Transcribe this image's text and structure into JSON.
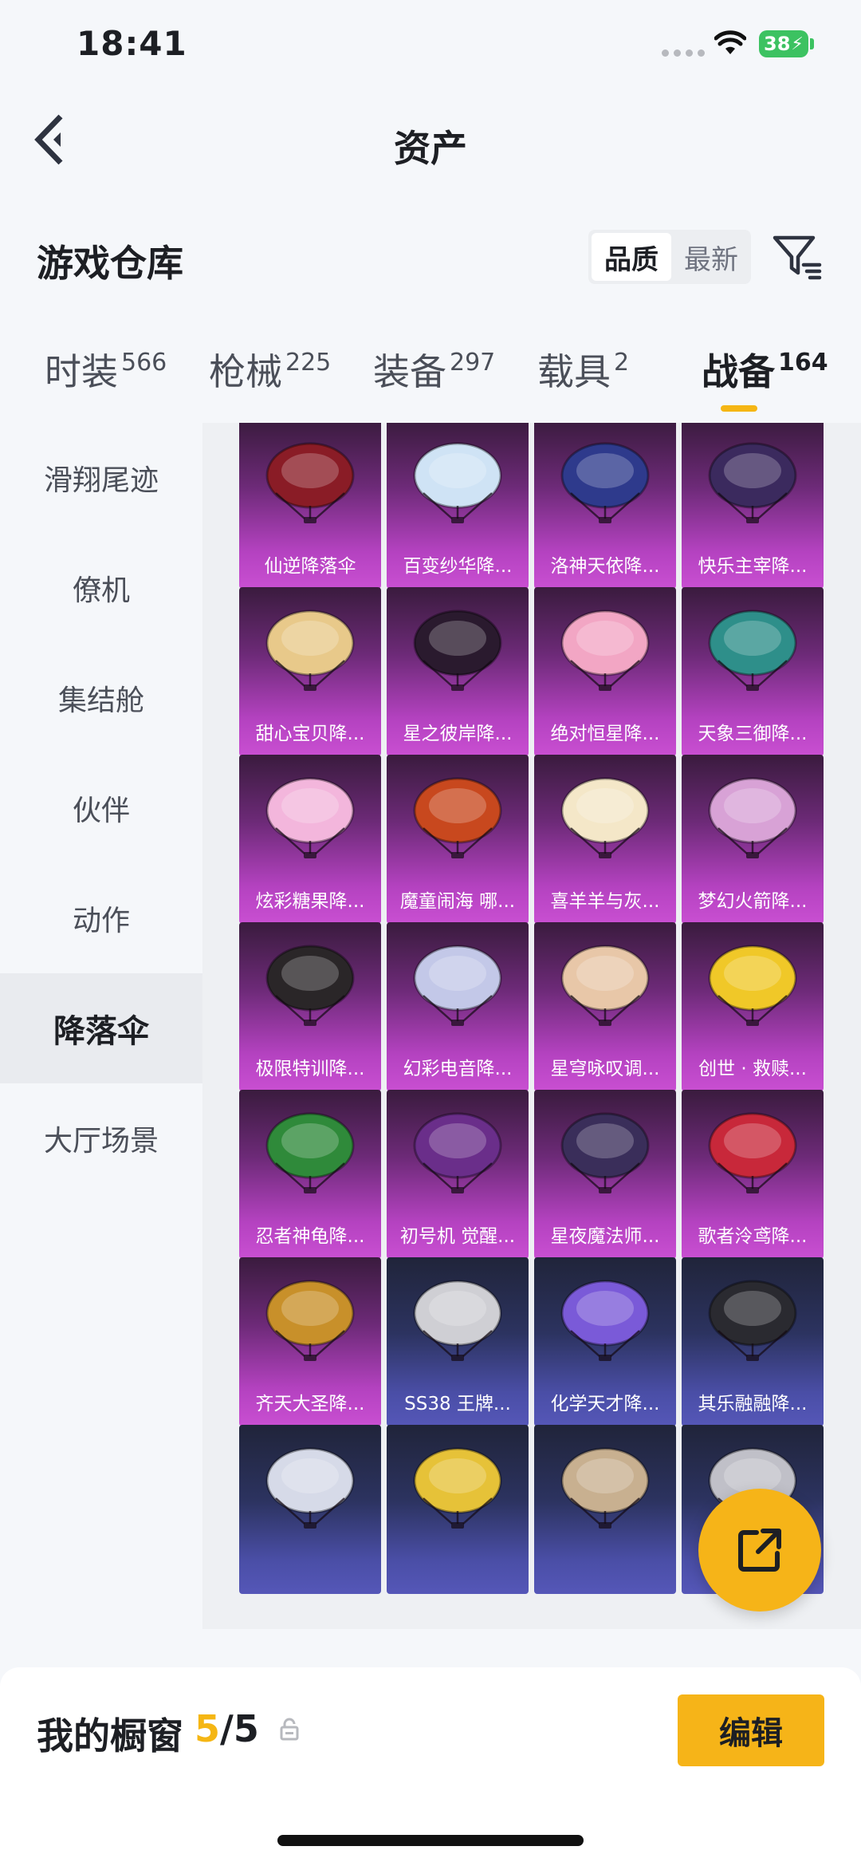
{
  "status": {
    "time": "18:41",
    "battery": "38"
  },
  "nav": {
    "title": "资产"
  },
  "warehouse": {
    "title": "游戏仓库",
    "sort_quality": "品质",
    "sort_latest": "最新"
  },
  "tabs": [
    {
      "label": "时装",
      "count": "566"
    },
    {
      "label": "枪械",
      "count": "225"
    },
    {
      "label": "装备",
      "count": "297"
    },
    {
      "label": "载具",
      "count": "2"
    },
    {
      "label": "战备",
      "count": "164"
    }
  ],
  "sidebar": [
    {
      "label": "滑翔尾迹"
    },
    {
      "label": "僚机"
    },
    {
      "label": "集结舱"
    },
    {
      "label": "伙伴"
    },
    {
      "label": "动作"
    },
    {
      "label": "降落伞"
    },
    {
      "label": "大厅场景"
    }
  ],
  "items": [
    {
      "label": "仙逆降落伞",
      "tone": "pink",
      "color": "#8a1c26"
    },
    {
      "label": "百变纱华降...",
      "tone": "pink",
      "color": "#cfe3f5"
    },
    {
      "label": "洛神天依降...",
      "tone": "pink",
      "color": "#2e3a8c"
    },
    {
      "label": "快乐主宰降...",
      "tone": "pink",
      "color": "#3b2a5e"
    },
    {
      "label": "甜心宝贝降...",
      "tone": "pink",
      "color": "#e8c98a"
    },
    {
      "label": "星之彼岸降...",
      "tone": "pink",
      "color": "#2a1a2e"
    },
    {
      "label": "绝对恒星降...",
      "tone": "pink",
      "color": "#f2a6c4"
    },
    {
      "label": "天象三御降...",
      "tone": "pink",
      "color": "#2e8f8a"
    },
    {
      "label": "炫彩糖果降...",
      "tone": "pink",
      "color": "#f3b6dc"
    },
    {
      "label": "魔童闹海 哪...",
      "tone": "pink",
      "color": "#c8481e"
    },
    {
      "label": "喜羊羊与灰...",
      "tone": "pink",
      "color": "#f4e7c8"
    },
    {
      "label": "梦幻火箭降...",
      "tone": "pink",
      "color": "#d8a2d6"
    },
    {
      "label": "极限特训降...",
      "tone": "pink",
      "color": "#2a2628"
    },
    {
      "label": "幻彩电音降...",
      "tone": "pink",
      "color": "#c3c8e8"
    },
    {
      "label": "星穹咏叹调...",
      "tone": "pink",
      "color": "#e8c7a8"
    },
    {
      "label": "创世 · 救赎...",
      "tone": "pink",
      "color": "#f0c828"
    },
    {
      "label": "忍者神龟降...",
      "tone": "pink",
      "color": "#2f8a3a"
    },
    {
      "label": "初号机 觉醒...",
      "tone": "pink",
      "color": "#6a2e8a"
    },
    {
      "label": "星夜魔法师...",
      "tone": "pink",
      "color": "#3a2e5a"
    },
    {
      "label": "歌者泠鸢降...",
      "tone": "pink",
      "color": "#c8283a"
    },
    {
      "label": "齐天大圣降...",
      "tone": "pink",
      "color": "#c8902a"
    },
    {
      "label": "SS38 王牌...",
      "tone": "blue",
      "color": "#cfcfd4"
    },
    {
      "label": "化学天才降...",
      "tone": "blue",
      "color": "#7a5ad8"
    },
    {
      "label": "其乐融融降...",
      "tone": "blue",
      "color": "#2a2a30"
    },
    {
      "label": "",
      "tone": "blue",
      "color": "#d6dae8"
    },
    {
      "label": "",
      "tone": "blue",
      "color": "#e6c238"
    },
    {
      "label": "",
      "tone": "blue",
      "color": "#c8b090"
    },
    {
      "label": "",
      "tone": "blue",
      "color": "#c0c0c8"
    }
  ],
  "showcase": {
    "label": "我的橱窗",
    "current": "5",
    "separator": "/",
    "total": "5",
    "edit": "编辑"
  }
}
